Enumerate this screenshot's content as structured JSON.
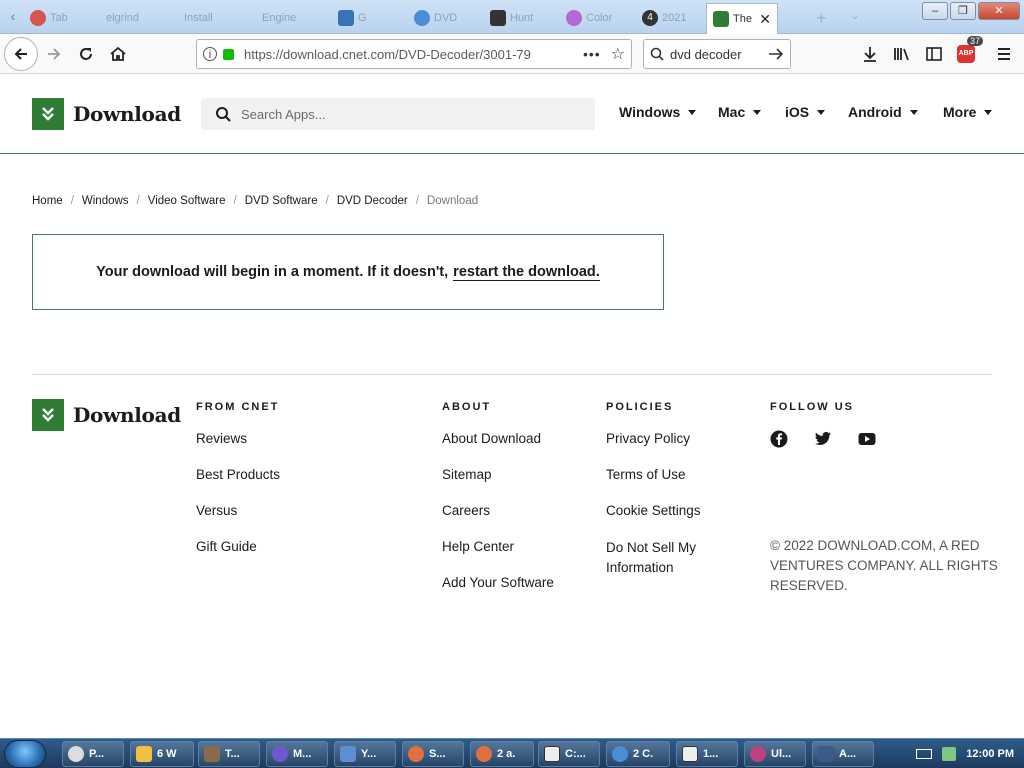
{
  "browser": {
    "tabs": [
      {
        "label": "Tab",
        "icon": "firefox-icon",
        "color": "#d9534f"
      },
      {
        "label": "elgrind",
        "icon": "page-icon",
        "color": "#b9d2ee"
      },
      {
        "label": "Install",
        "icon": "page-icon",
        "color": "#b9d2ee"
      },
      {
        "label": "Engine",
        "icon": "page-icon",
        "color": "#b9d2ee"
      },
      {
        "label": "G",
        "icon": "shield-icon",
        "color": "#3b73b9"
      },
      {
        "label": "DVD",
        "icon": "globe-icon",
        "color": "#4a8fd6"
      },
      {
        "label": "Hunt",
        "icon": "library-icon",
        "color": "#333333"
      },
      {
        "label": "Color",
        "icon": "circle-icon",
        "color": "#b06ad0"
      },
      {
        "label": "2021",
        "icon": "number-icon",
        "color": "#333333"
      },
      {
        "label": "The",
        "icon": "download-favicon",
        "color": "#2f7d32",
        "active": true
      }
    ],
    "url": "https://download.cnet.com/DVD-Decoder/3001-79",
    "search_value": "dvd decoder",
    "abp_count": "37"
  },
  "site": {
    "logo_text": "Download",
    "search_placeholder": "Search Apps...",
    "nav": [
      "Windows",
      "Mac",
      "iOS",
      "Android",
      "More"
    ],
    "brand_color": "#2f7d32"
  },
  "breadcrumb": [
    "Home",
    "Windows",
    "Video Software",
    "DVD Software",
    "DVD Decoder",
    "Download"
  ],
  "notice": {
    "text": "Your download will begin in a moment. If it doesn't,",
    "link": "restart the download."
  },
  "footer": {
    "logo_text": "Download",
    "from_cnet": {
      "heading": "FROM CNET",
      "links": [
        "Reviews",
        "Best Products",
        "Versus",
        "Gift Guide"
      ]
    },
    "about": {
      "heading": "ABOUT",
      "links": [
        "About Download",
        "Sitemap",
        "Careers",
        "Help Center",
        "Add Your Software"
      ]
    },
    "policies": {
      "heading": "POLICIES",
      "links": [
        "Privacy Policy",
        "Terms of Use",
        "Cookie Settings",
        "Do Not Sell My Information"
      ]
    },
    "follow": {
      "heading": "FOLLOW US",
      "networks": [
        "facebook-icon",
        "twitter-icon",
        "youtube-icon"
      ]
    },
    "copyright": "© 2022 DOWNLOAD.COM, A RED VENTURES COMPANY. ALL RIGHTS RESERVED."
  },
  "taskbar": {
    "items": [
      "P...",
      "6 W",
      "T...",
      "M...",
      "Y...",
      "S...",
      "2 a.",
      "C:...",
      "2 C.",
      "1...",
      "Ul...",
      "A..."
    ],
    "clock": "12:00 PM"
  }
}
